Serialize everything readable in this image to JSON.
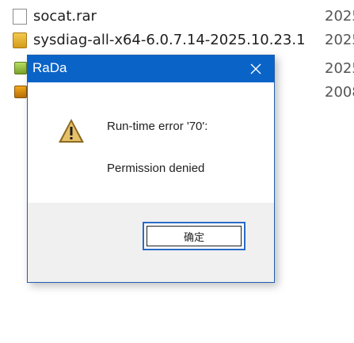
{
  "files": [
    {
      "name": "socat.rar",
      "date": "2025",
      "icon": "document-icon"
    },
    {
      "name": "sysdiag-all-x64-6.0.7.14-2025.10.23.1",
      "date": "2025",
      "icon": "installer-icon"
    },
    {
      "name": "",
      "date": "2025",
      "icon": "app-icon"
    },
    {
      "name": "",
      "date": "2008",
      "icon": "app-icon"
    }
  ],
  "dialog": {
    "title": "RaDa",
    "message_line1": "Run-time error '70':",
    "message_line2": "Permission denied",
    "ok_label": "确定"
  },
  "colors": {
    "titlebar": "#0a64c8",
    "button_border": "#2a6bc7"
  }
}
